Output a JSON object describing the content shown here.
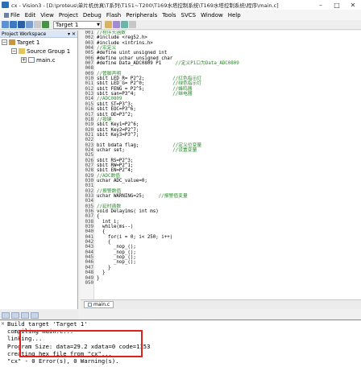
{
  "window": {
    "title": "cx - Vision3 - [D:\\proteus\\单片机仿真\\T系列\\T151~T200\\T169水塔控制系统\\T169水塔控制系统\\程序\\main.c]",
    "minimize": "–",
    "maximize": "□",
    "close": "✕"
  },
  "menu": {
    "items": [
      "File",
      "Edit",
      "View",
      "Project",
      "Debug",
      "Flash",
      "Peripherals",
      "Tools",
      "SVCS",
      "Window",
      "Help"
    ]
  },
  "toolbar": {
    "target": "Target 1"
  },
  "workspace": {
    "title": "Project Workspace",
    "controls": "▾ ✕",
    "tree": [
      {
        "label": "Target 1"
      },
      {
        "label": "Source Group 1"
      },
      {
        "label": "main.c"
      }
    ]
  },
  "editor": {
    "lines": [
      {
        "n": "001",
        "code": "//程序头函数",
        "cls": "c-comment"
      },
      {
        "n": "002",
        "code": "#include <reg52.h>",
        "cls": ""
      },
      {
        "n": "003",
        "code": "#include <intrins.h>",
        "cls": ""
      },
      {
        "n": "004",
        "code": "//宏定义",
        "cls": "c-comment"
      },
      {
        "n": "005",
        "code": "#define uint unsigned int",
        "cls": ""
      },
      {
        "n": "006",
        "code": "#define uchar unsigned char",
        "cls": ""
      },
      {
        "n": "007",
        "code": "#define Data_ADC0809 P1     //定义P1口为Data_ADC0809",
        "cls": "mixed"
      },
      {
        "n": "008",
        "code": "",
        "cls": ""
      },
      {
        "n": "009",
        "code": "//管脚声明",
        "cls": "c-comment"
      },
      {
        "n": "010",
        "code": "sbit LED_R= P2^2;          //红色指示灯",
        "cls": "mixed"
      },
      {
        "n": "011",
        "code": "sbit LED_G= P2^0;          //绿色指示灯",
        "cls": "mixed"
      },
      {
        "n": "012",
        "code": "sbit FENG = P2^5;          //蜂鸣器",
        "cls": "mixed"
      },
      {
        "n": "013",
        "code": "sbit san=P3^4;             //继电器",
        "cls": "mixed"
      },
      {
        "n": "014",
        "code": "//ADC0809",
        "cls": "c-comment"
      },
      {
        "n": "015",
        "code": "sbit ST=P3^3;",
        "cls": ""
      },
      {
        "n": "016",
        "code": "sbit EOC=P3^6;",
        "cls": ""
      },
      {
        "n": "017",
        "code": "sbit OE=P3^2;",
        "cls": ""
      },
      {
        "n": "018",
        "code": "//按键",
        "cls": "c-comment"
      },
      {
        "n": "019",
        "code": "sbit Key1=P2^6;",
        "cls": ""
      },
      {
        "n": "020",
        "code": "sbit Key2=P2^7;",
        "cls": ""
      },
      {
        "n": "021",
        "code": "sbit Key3=P3^7;",
        "cls": ""
      },
      {
        "n": "022",
        "code": "",
        "cls": ""
      },
      {
        "n": "023",
        "code": "bit bdata flag;            //定义位变量",
        "cls": "mixed"
      },
      {
        "n": "024",
        "code": "uchar set;                 //设置变量",
        "cls": "mixed"
      },
      {
        "n": "025",
        "code": "",
        "cls": ""
      },
      {
        "n": "026",
        "code": "sbit RS=P2^3;",
        "cls": ""
      },
      {
        "n": "027",
        "code": "sbit RW=P2^1;",
        "cls": ""
      },
      {
        "n": "028",
        "code": "sbit EN=P2^4;",
        "cls": ""
      },
      {
        "n": "029",
        "code": "//ADC数值",
        "cls": "c-comment"
      },
      {
        "n": "030",
        "code": "uchar ADC_value=0;",
        "cls": ""
      },
      {
        "n": "031",
        "code": "",
        "cls": ""
      },
      {
        "n": "032",
        "code": "//报警数值",
        "cls": "c-comment"
      },
      {
        "n": "033",
        "code": "uchar WARNING=25;     //报警值变量",
        "cls": "mixed"
      },
      {
        "n": "034",
        "code": "",
        "cls": ""
      },
      {
        "n": "035",
        "code": "//延时函数",
        "cls": "c-comment"
      },
      {
        "n": "036",
        "code": "void Delay1ms( int ms)",
        "cls": ""
      },
      {
        "n": "037",
        "code": "{",
        "cls": ""
      },
      {
        "n": "038",
        "code": "  int i;",
        "cls": ""
      },
      {
        "n": "039",
        "code": "  while(ms--)",
        "cls": ""
      },
      {
        "n": "040",
        "code": "  {",
        "cls": ""
      },
      {
        "n": "041",
        "code": "    for(i = 0; i< 250; i++)",
        "cls": ""
      },
      {
        "n": "042",
        "code": "    {",
        "cls": ""
      },
      {
        "n": "043",
        "code": "      _nop_();",
        "cls": ""
      },
      {
        "n": "044",
        "code": "      _nop_();",
        "cls": ""
      },
      {
        "n": "045",
        "code": "      _nop_();",
        "cls": ""
      },
      {
        "n": "046",
        "code": "      _nop_();",
        "cls": ""
      },
      {
        "n": "047",
        "code": "    }",
        "cls": ""
      },
      {
        "n": "048",
        "code": "  }",
        "cls": ""
      },
      {
        "n": "049",
        "code": "}",
        "cls": ""
      },
      {
        "n": "050",
        "code": "",
        "cls": ""
      }
    ],
    "tab": "main.c"
  },
  "build": {
    "close": "✕",
    "lines": [
      "Build target 'Target 1'",
      "compiling main.c...",
      "linking...",
      "Program Size: data=29.2 xdata=0 code=1153",
      "creating hex file from \"cx\"...",
      "\"cx\" - 0 Error(s), 0 Warning(s)."
    ],
    "highlight_color": "#e0201a"
  },
  "colors": {
    "comment": "#2a8a2a",
    "keyword": "#0000c8"
  }
}
